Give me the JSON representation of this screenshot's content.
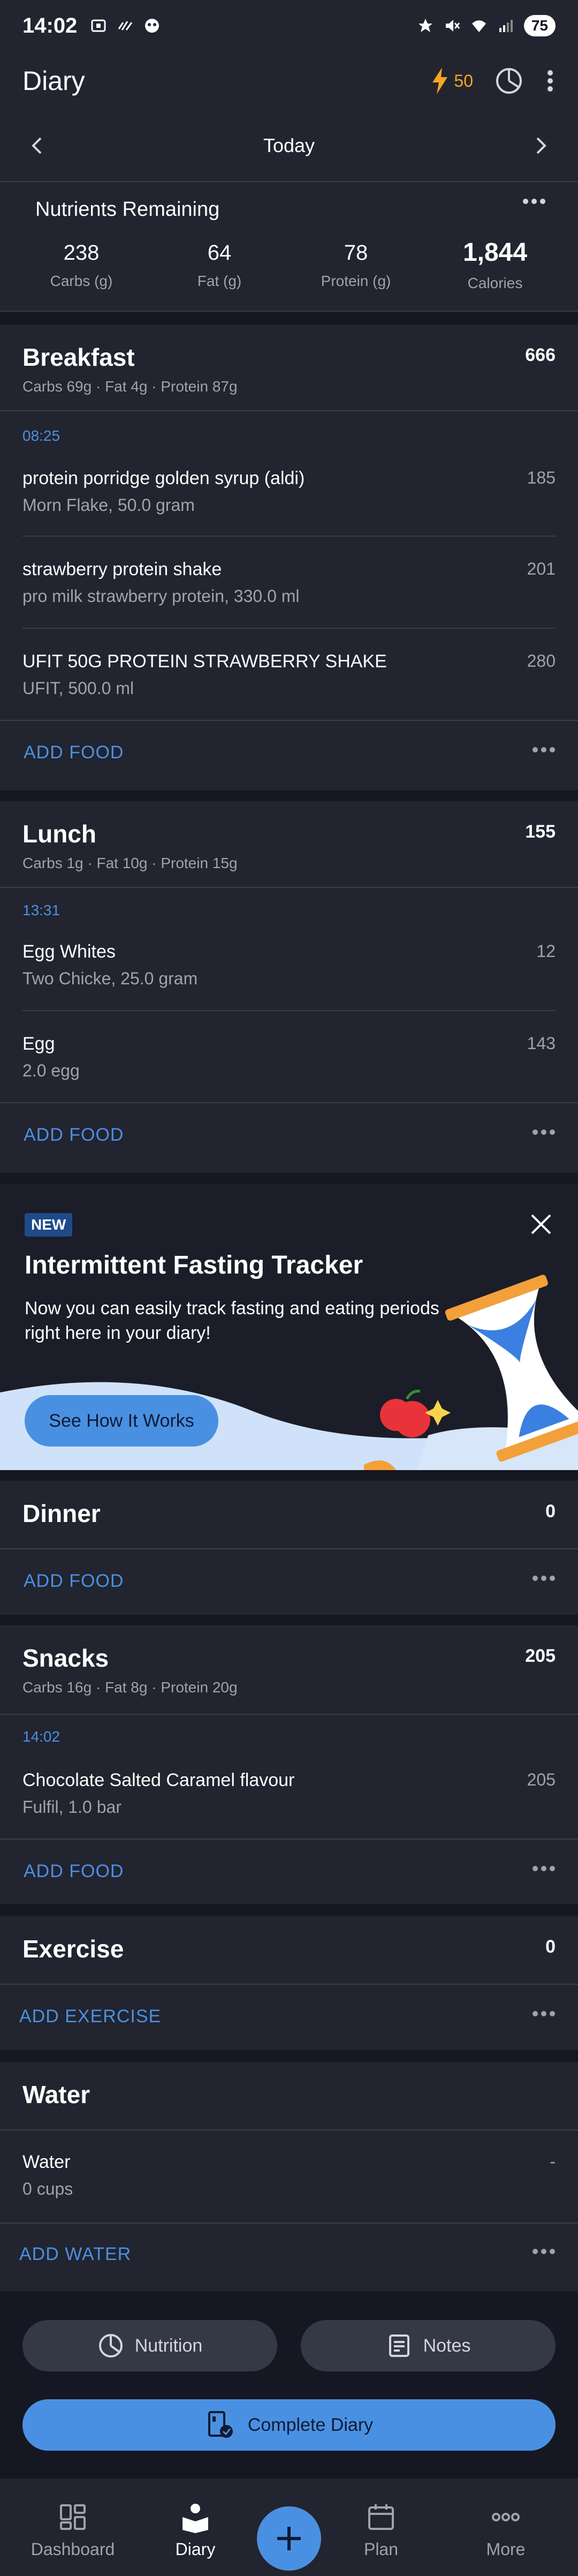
{
  "status_bar": {
    "time": "14:02",
    "battery": "75",
    "icons": [
      "screenshot-icon",
      "wave-icon",
      "smiley-icon",
      "star-icon",
      "mute-icon",
      "wifi-icon",
      "signal-icon",
      "battery-icon"
    ]
  },
  "header": {
    "title": "Diary",
    "streak_count": "50",
    "icons": [
      "lightning-icon",
      "pie-chart-icon",
      "more-vertical-icon"
    ]
  },
  "date_nav": {
    "label": "Today"
  },
  "nutrients": {
    "title": "Nutrients Remaining",
    "items": [
      {
        "value": "238",
        "label": "Carbs (g)"
      },
      {
        "value": "64",
        "label": "Fat (g)"
      },
      {
        "value": "78",
        "label": "Protein (g)"
      },
      {
        "value": "1,844",
        "label": "Calories"
      }
    ]
  },
  "breakfast": {
    "name": "Breakfast",
    "calories": "666",
    "macros": "Carbs 69g · Fat 4g · Protein 87g",
    "time": "08:25",
    "items": [
      {
        "name": "protein porridge golden syrup (aldi)",
        "detail": "Morn Flake, 50.0 gram",
        "calories": "185"
      },
      {
        "name": "strawberry protein shake",
        "detail": "pro milk strawberry protein, 330.0 ml",
        "calories": "201"
      },
      {
        "name": "UFIT 50G PROTEIN STRAWBERRY SHAKE",
        "detail": "UFIT, 500.0 ml",
        "calories": "280"
      }
    ],
    "add_label": "ADD FOOD"
  },
  "lunch": {
    "name": "Lunch",
    "calories": "155",
    "macros": "Carbs 1g · Fat 10g · Protein 15g",
    "time": "13:31",
    "items": [
      {
        "name": "Egg Whites",
        "detail": "Two Chicke, 25.0 gram",
        "calories": "12"
      },
      {
        "name": "Egg",
        "detail": "2.0 egg",
        "calories": "143"
      }
    ],
    "add_label": "ADD FOOD"
  },
  "promo": {
    "badge": "NEW",
    "title": "Intermittent Fasting Tracker",
    "description": "Now you can easily track fasting and eating periods right here in your diary!",
    "button": "See How It Works"
  },
  "dinner": {
    "name": "Dinner",
    "calories": "0",
    "add_label": "ADD FOOD"
  },
  "snacks": {
    "name": "Snacks",
    "calories": "205",
    "macros": "Carbs 16g · Fat 8g · Protein 20g",
    "time": "14:02",
    "items": [
      {
        "name": "Chocolate Salted Caramel flavour",
        "detail": "Fulfil, 1.0 bar",
        "calories": "205"
      }
    ],
    "add_label": "ADD FOOD"
  },
  "exercise": {
    "name": "Exercise",
    "calories": "0",
    "add_label": "ADD EXERCISE"
  },
  "water": {
    "name": "Water",
    "item_name": "Water",
    "item_detail": "0 cups",
    "item_value": "-",
    "add_label": "ADD WATER"
  },
  "actions": {
    "nutrition": "Nutrition",
    "notes": "Notes",
    "complete": "Complete Diary"
  },
  "bottom_nav": {
    "dashboard": "Dashboard",
    "diary": "Diary",
    "plan": "Plan",
    "more": "More"
  },
  "colors": {
    "background": "#151722",
    "card": "#22242F",
    "accent": "#4A90E2",
    "streak": "#F5A623"
  }
}
